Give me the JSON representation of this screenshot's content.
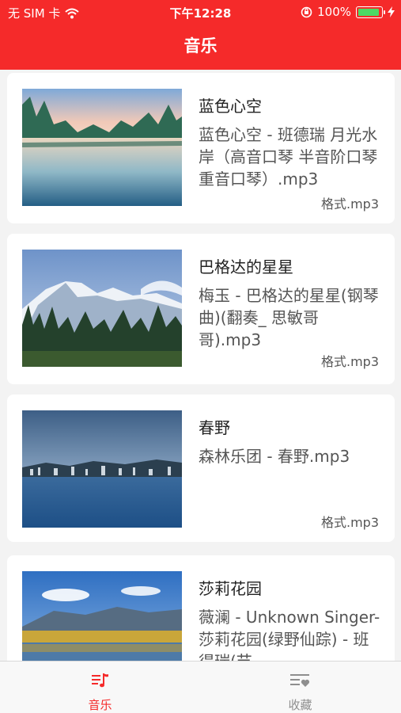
{
  "status": {
    "carrier": "无 SIM 卡",
    "time": "下午12:28",
    "battery": "100%"
  },
  "header": {
    "title": "音乐"
  },
  "songs": [
    {
      "title": "蓝色心空",
      "file": "蓝色心空 - 班德瑞 月光水岸（高音口琴 半音阶口琴 重音口琴）.mp3",
      "format": "格式.mp3"
    },
    {
      "title": "巴格达的星星",
      "file": "梅玉 - 巴格达的星星(钢琴曲)(翻奏_ 思敏哥哥).mp3",
      "format": "格式.mp3"
    },
    {
      "title": "春野",
      "file": "森林乐团 - 春野.mp3",
      "format": "格式.mp3"
    },
    {
      "title": "莎莉花园",
      "file": "薇澜 - Unknown Singer-莎莉花园(绿野仙踪) - 班得瑞(节",
      "format": ""
    }
  ],
  "tabs": [
    {
      "label": "音乐",
      "active": true
    },
    {
      "label": "收藏",
      "active": false
    }
  ],
  "colors": {
    "accent": "#f52a2a",
    "inactive": "#8e8e8e"
  }
}
